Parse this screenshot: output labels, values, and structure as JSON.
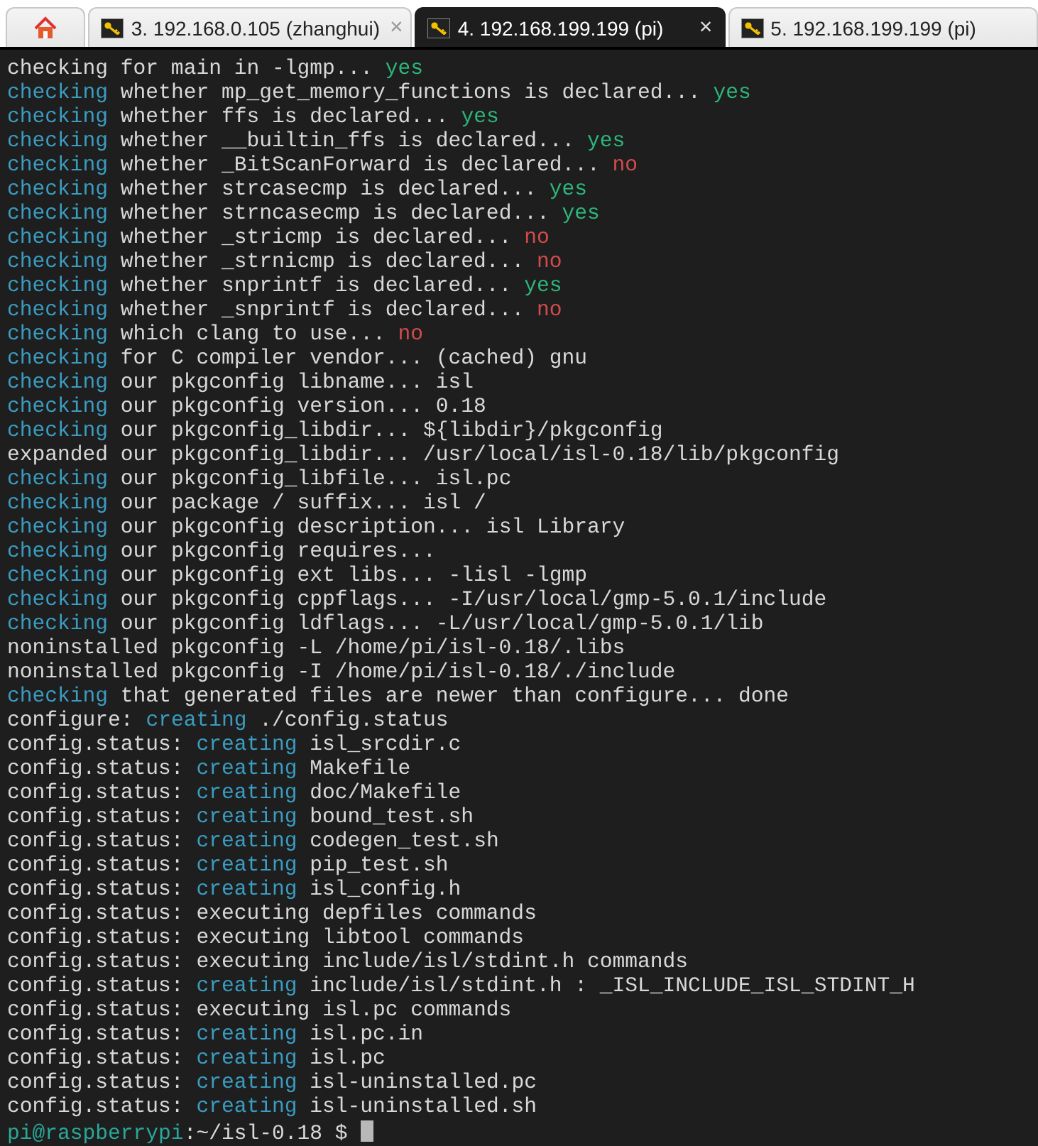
{
  "tabs": [
    {
      "kind": "home",
      "selected": false
    },
    {
      "kind": "session",
      "label": "3. 192.168.0.105 (zhanghui)",
      "selected": false,
      "close": "×"
    },
    {
      "kind": "session",
      "label": "4. 192.168.199.199 (pi)",
      "selected": true,
      "close": "×"
    },
    {
      "kind": "session",
      "label": "5. 192.168.199.199 (pi)",
      "selected": false
    }
  ],
  "terminal": {
    "cursor": true,
    "lines": [
      [
        {
          "kind": "plain",
          "text": "checking for main in -lgmp... "
        },
        {
          "kind": "yes",
          "text": "yes"
        }
      ],
      [
        {
          "kind": "keyword",
          "text": "checking"
        },
        {
          "kind": "plain",
          "text": " whether mp_get_memory_functions is declared... "
        },
        {
          "kind": "yes",
          "text": "yes"
        }
      ],
      [
        {
          "kind": "keyword",
          "text": "checking"
        },
        {
          "kind": "plain",
          "text": " whether ffs is declared... "
        },
        {
          "kind": "yes",
          "text": "yes"
        }
      ],
      [
        {
          "kind": "keyword",
          "text": "checking"
        },
        {
          "kind": "plain",
          "text": " whether __builtin_ffs is declared... "
        },
        {
          "kind": "yes",
          "text": "yes"
        }
      ],
      [
        {
          "kind": "keyword",
          "text": "checking"
        },
        {
          "kind": "plain",
          "text": " whether _BitScanForward is declared... "
        },
        {
          "kind": "no",
          "text": "no"
        }
      ],
      [
        {
          "kind": "keyword",
          "text": "checking"
        },
        {
          "kind": "plain",
          "text": " whether strcasecmp is declared... "
        },
        {
          "kind": "yes",
          "text": "yes"
        }
      ],
      [
        {
          "kind": "keyword",
          "text": "checking"
        },
        {
          "kind": "plain",
          "text": " whether strncasecmp is declared... "
        },
        {
          "kind": "yes",
          "text": "yes"
        }
      ],
      [
        {
          "kind": "keyword",
          "text": "checking"
        },
        {
          "kind": "plain",
          "text": " whether _stricmp is declared... "
        },
        {
          "kind": "no",
          "text": "no"
        }
      ],
      [
        {
          "kind": "keyword",
          "text": "checking"
        },
        {
          "kind": "plain",
          "text": " whether _strnicmp is declared... "
        },
        {
          "kind": "no",
          "text": "no"
        }
      ],
      [
        {
          "kind": "keyword",
          "text": "checking"
        },
        {
          "kind": "plain",
          "text": " whether snprintf is declared... "
        },
        {
          "kind": "yes",
          "text": "yes"
        }
      ],
      [
        {
          "kind": "keyword",
          "text": "checking"
        },
        {
          "kind": "plain",
          "text": " whether _snprintf is declared... "
        },
        {
          "kind": "no",
          "text": "no"
        }
      ],
      [
        {
          "kind": "keyword",
          "text": "checking"
        },
        {
          "kind": "plain",
          "text": " which clang to use... "
        },
        {
          "kind": "no",
          "text": "no"
        }
      ],
      [
        {
          "kind": "keyword",
          "text": "checking"
        },
        {
          "kind": "plain",
          "text": " for C compiler vendor... (cached) gnu"
        }
      ],
      [
        {
          "kind": "keyword",
          "text": "checking"
        },
        {
          "kind": "plain",
          "text": " our pkgconfig libname... isl"
        }
      ],
      [
        {
          "kind": "keyword",
          "text": "checking"
        },
        {
          "kind": "plain",
          "text": " our pkgconfig version... 0.18"
        }
      ],
      [
        {
          "kind": "keyword",
          "text": "checking"
        },
        {
          "kind": "plain",
          "text": " our pkgconfig_libdir... ${libdir}/pkgconfig"
        }
      ],
      [
        {
          "kind": "plain",
          "text": "expanded our pkgconfig_libdir... /usr/local/isl-0.18/lib/pkgconfig"
        }
      ],
      [
        {
          "kind": "keyword",
          "text": "checking"
        },
        {
          "kind": "plain",
          "text": " our pkgconfig_libfile... isl.pc"
        }
      ],
      [
        {
          "kind": "keyword",
          "text": "checking"
        },
        {
          "kind": "plain",
          "text": " our package / suffix... isl /"
        }
      ],
      [
        {
          "kind": "keyword",
          "text": "checking"
        },
        {
          "kind": "plain",
          "text": " our pkgconfig description... isl Library"
        }
      ],
      [
        {
          "kind": "keyword",
          "text": "checking"
        },
        {
          "kind": "plain",
          "text": " our pkgconfig requires..."
        }
      ],
      [
        {
          "kind": "keyword",
          "text": "checking"
        },
        {
          "kind": "plain",
          "text": " our pkgconfig ext libs... -lisl -lgmp"
        }
      ],
      [
        {
          "kind": "keyword",
          "text": "checking"
        },
        {
          "kind": "plain",
          "text": " our pkgconfig cppflags... -I/usr/local/gmp-5.0.1/include"
        }
      ],
      [
        {
          "kind": "keyword",
          "text": "checking"
        },
        {
          "kind": "plain",
          "text": " our pkgconfig ldflags... -L/usr/local/gmp-5.0.1/lib"
        }
      ],
      [
        {
          "kind": "plain",
          "text": "noninstalled pkgconfig -L /home/pi/isl-0.18/.libs"
        }
      ],
      [
        {
          "kind": "plain",
          "text": "noninstalled pkgconfig -I /home/pi/isl-0.18/./include"
        }
      ],
      [
        {
          "kind": "keyword",
          "text": "checking"
        },
        {
          "kind": "plain",
          "text": " that generated files are newer than configure... done"
        }
      ],
      [
        {
          "kind": "plain",
          "text": "configure: "
        },
        {
          "kind": "keyword",
          "text": "creating"
        },
        {
          "kind": "plain",
          "text": " ./config.status"
        }
      ],
      [
        {
          "kind": "plain",
          "text": "config.status: "
        },
        {
          "kind": "keyword",
          "text": "creating"
        },
        {
          "kind": "plain",
          "text": " isl_srcdir.c"
        }
      ],
      [
        {
          "kind": "plain",
          "text": "config.status: "
        },
        {
          "kind": "keyword",
          "text": "creating"
        },
        {
          "kind": "plain",
          "text": " Makefile"
        }
      ],
      [
        {
          "kind": "plain",
          "text": "config.status: "
        },
        {
          "kind": "keyword",
          "text": "creating"
        },
        {
          "kind": "plain",
          "text": " doc/Makefile"
        }
      ],
      [
        {
          "kind": "plain",
          "text": "config.status: "
        },
        {
          "kind": "keyword",
          "text": "creating"
        },
        {
          "kind": "plain",
          "text": " bound_test.sh"
        }
      ],
      [
        {
          "kind": "plain",
          "text": "config.status: "
        },
        {
          "kind": "keyword",
          "text": "creating"
        },
        {
          "kind": "plain",
          "text": " codegen_test.sh"
        }
      ],
      [
        {
          "kind": "plain",
          "text": "config.status: "
        },
        {
          "kind": "keyword",
          "text": "creating"
        },
        {
          "kind": "plain",
          "text": " pip_test.sh"
        }
      ],
      [
        {
          "kind": "plain",
          "text": "config.status: "
        },
        {
          "kind": "keyword",
          "text": "creating"
        },
        {
          "kind": "plain",
          "text": " isl_config.h"
        }
      ],
      [
        {
          "kind": "plain",
          "text": "config.status: executing depfiles commands"
        }
      ],
      [
        {
          "kind": "plain",
          "text": "config.status: executing libtool commands"
        }
      ],
      [
        {
          "kind": "plain",
          "text": "config.status: executing include/isl/stdint.h commands"
        }
      ],
      [
        {
          "kind": "plain",
          "text": "config.status: "
        },
        {
          "kind": "keyword",
          "text": "creating"
        },
        {
          "kind": "plain",
          "text": " include/isl/stdint.h : _ISL_INCLUDE_ISL_STDINT_H"
        }
      ],
      [
        {
          "kind": "plain",
          "text": "config.status: executing isl.pc commands"
        }
      ],
      [
        {
          "kind": "plain",
          "text": "config.status: "
        },
        {
          "kind": "keyword",
          "text": "creating"
        },
        {
          "kind": "plain",
          "text": " isl.pc.in"
        }
      ],
      [
        {
          "kind": "plain",
          "text": "config.status: "
        },
        {
          "kind": "keyword",
          "text": "creating"
        },
        {
          "kind": "plain",
          "text": " isl.pc"
        }
      ],
      [
        {
          "kind": "plain",
          "text": "config.status: "
        },
        {
          "kind": "keyword",
          "text": "creating"
        },
        {
          "kind": "plain",
          "text": " isl-uninstalled.pc"
        }
      ],
      [
        {
          "kind": "plain",
          "text": "config.status: "
        },
        {
          "kind": "keyword",
          "text": "creating"
        },
        {
          "kind": "plain",
          "text": " isl-uninstalled.sh"
        }
      ],
      [
        {
          "kind": "prompt",
          "text": "pi@raspberrypi"
        },
        {
          "kind": "plain",
          "text": ":~/isl-0.18 $ "
        }
      ]
    ]
  }
}
